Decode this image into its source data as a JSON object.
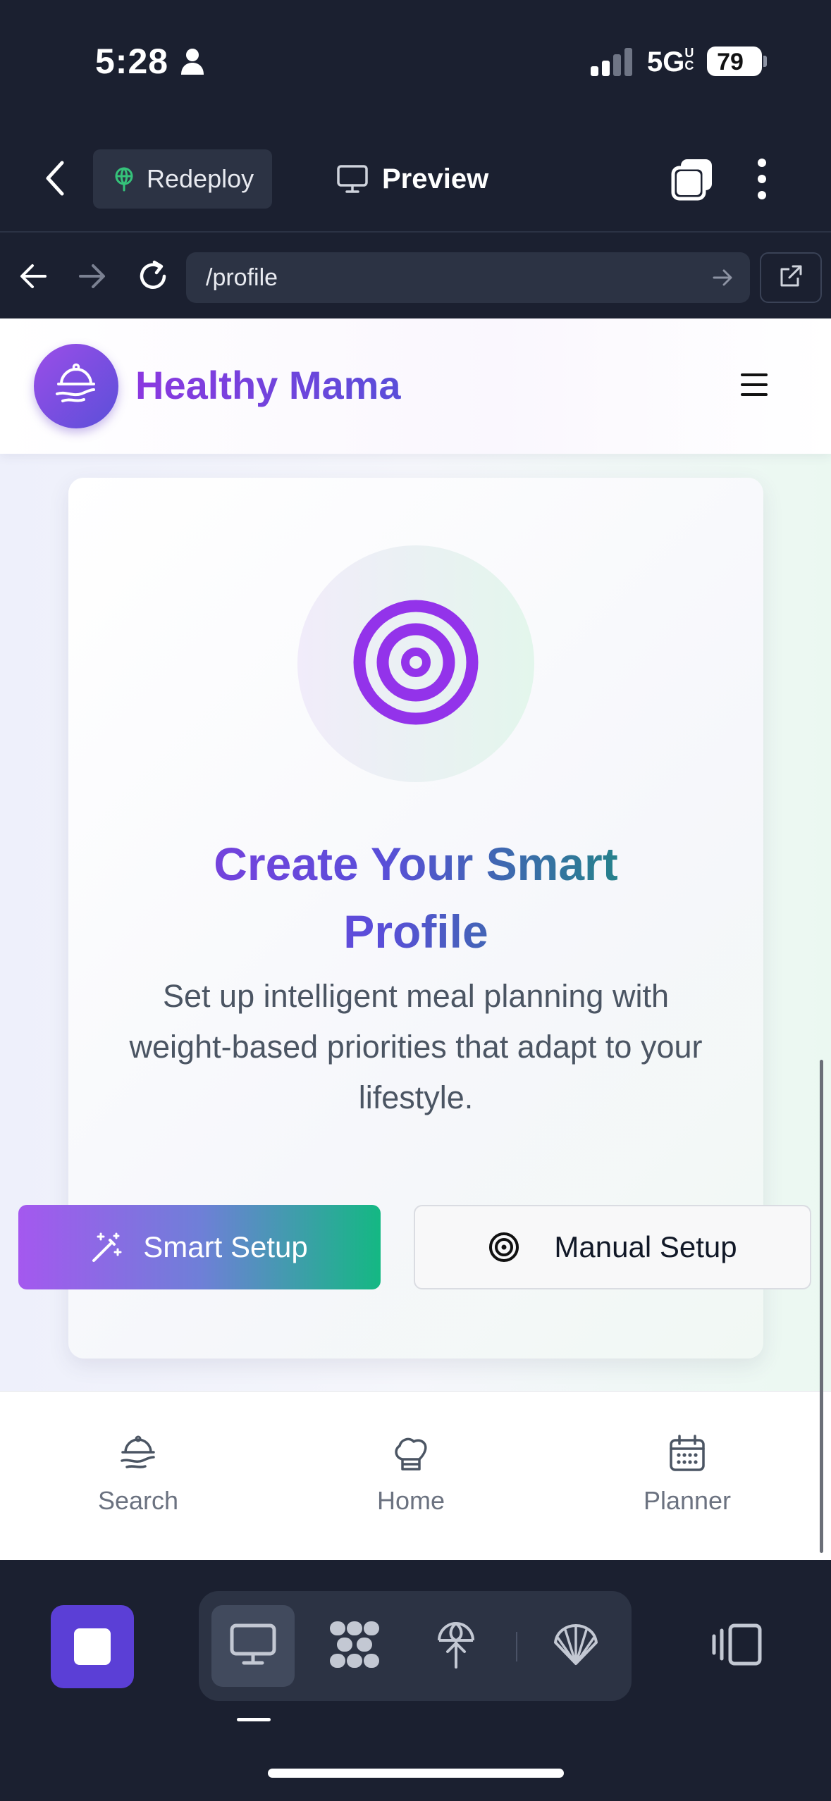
{
  "status_bar": {
    "time": "5:28",
    "network": "5G",
    "network_sub": "UC",
    "battery": "79",
    "battery_level_pct": 79
  },
  "toolbar": {
    "redeploy_label": "Redeploy",
    "preview_label": "Preview"
  },
  "browser": {
    "url": "/profile"
  },
  "site": {
    "brand": "Healthy Mama"
  },
  "card": {
    "title": "Create Your Smart Profile",
    "subtitle": "Set up intelligent meal planning with weight-based priorities that adapt to your lifestyle.",
    "smart_setup_label": "Smart Setup",
    "manual_setup_label": "Manual Setup"
  },
  "bottom_nav": {
    "items": [
      {
        "label": "Search"
      },
      {
        "label": "Home"
      },
      {
        "label": "Planner"
      }
    ]
  },
  "colors": {
    "brand_purple": "#8b38e0",
    "brand_indigo": "#5a4ed9",
    "brand_teal": "#14b883",
    "dark_chrome": "#1b2030"
  }
}
